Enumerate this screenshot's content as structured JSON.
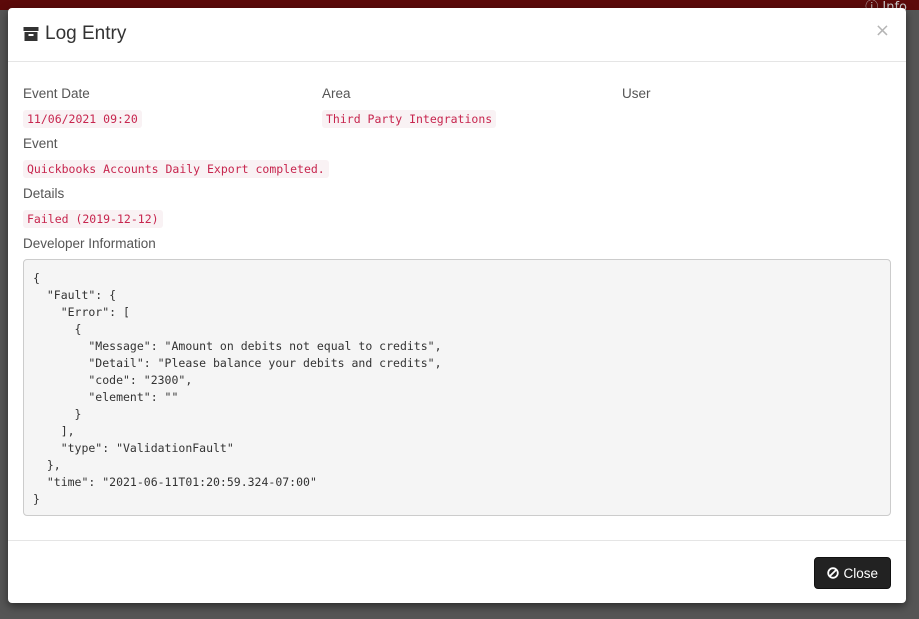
{
  "topbar": {
    "info_label": "Info"
  },
  "modal": {
    "title": "Log Entry",
    "title_icon": "archive-icon",
    "close_glyph": "×",
    "fields": {
      "event_date_label": "Event Date",
      "event_date_value": "11/06/2021 09:20",
      "area_label": "Area",
      "area_value": "Third Party Integrations",
      "user_label": "User",
      "event_label": "Event",
      "event_value": "Quickbooks Accounts Daily Export completed.",
      "details_label": "Details",
      "details_value": "Failed (2019-12-12)",
      "developer_label": "Developer Information"
    },
    "developer_info": "{\n  \"Fault\": {\n    \"Error\": [\n      {\n        \"Message\": \"Amount on debits not equal to credits\",\n        \"Detail\": \"Please balance your debits and credits\",\n        \"code\": \"2300\",\n        \"element\": \"\"\n      }\n    ],\n    \"type\": \"ValidationFault\"\n  },\n  \"time\": \"2021-06-11T01:20:59.324-07:00\"\n}",
    "footer": {
      "close_label": "Close",
      "close_icon": "ban-icon"
    }
  },
  "colors": {
    "tag_text": "#c7254e",
    "tag_bg": "#f9f2f4",
    "button_bg": "#222222",
    "topbar_bg": "#5c0a0a"
  }
}
